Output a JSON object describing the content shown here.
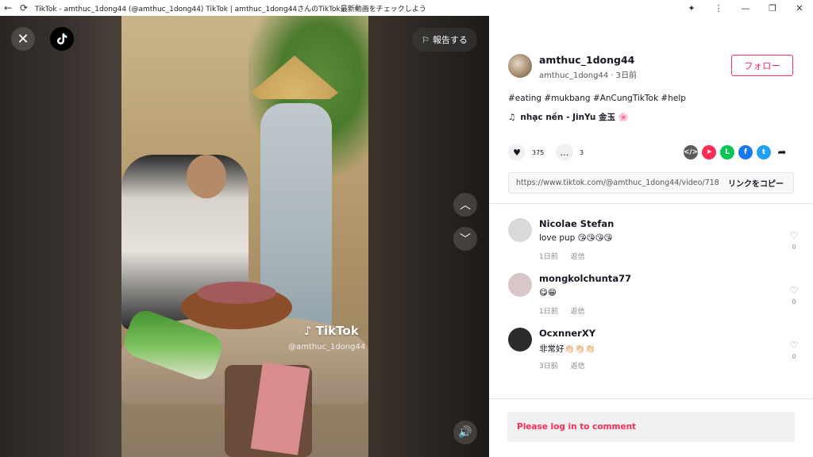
{
  "window": {
    "title": "TikTok - amthuc_1dong44 (@amthuc_1dong44) TikTok | amthuc_1dong44さんのTikTok最新動画をチェックしよう"
  },
  "video": {
    "watermark": "TikTok",
    "watermark_handle": "@amthuc_1dong44",
    "report_label": "報告する"
  },
  "post": {
    "author_name": "amthuc_1dong44",
    "author_sub": "amthuc_1dong44 · 3日前",
    "follow_label": "フォロー",
    "description": "#eating #mukbang #AnCungTikTok #help",
    "music": "nhạc nền - JinYu 金玉 🌸",
    "likes": "375",
    "comments": "3",
    "link_url": "https://www.tiktok.com/@amthuc_1dong44/video/718...",
    "copy_label": "リンクをコピー"
  },
  "comments": [
    {
      "name": "Nicolae Stefan",
      "text": "love pup 😘😘😘😘",
      "time": "1日前",
      "reply": "返信",
      "likes": "0",
      "avatar_color": "#d9d9db"
    },
    {
      "name": "mongkolchunta77",
      "text": "😋😁",
      "time": "1日前",
      "reply": "返信",
      "likes": "0",
      "avatar_color": "#d9c6c8"
    },
    {
      "name": "OcxnnerXY",
      "text": "非常好👏🏻👏🏻👏🏻",
      "time": "3日前",
      "reply": "返信",
      "likes": "0",
      "avatar_color": "#2b2b2b"
    }
  ],
  "footer": {
    "login_prompt": "Please log in to comment"
  },
  "colors": {
    "accent": "#fe2c55",
    "muted": "#8a8b91"
  },
  "icons": {
    "back": "arrow-left-icon",
    "reload": "reload-icon",
    "extensions": "puzzle-icon",
    "menu": "kebab-menu-icon",
    "minimize": "minimize-icon",
    "restore": "restore-icon",
    "close": "close-icon"
  }
}
